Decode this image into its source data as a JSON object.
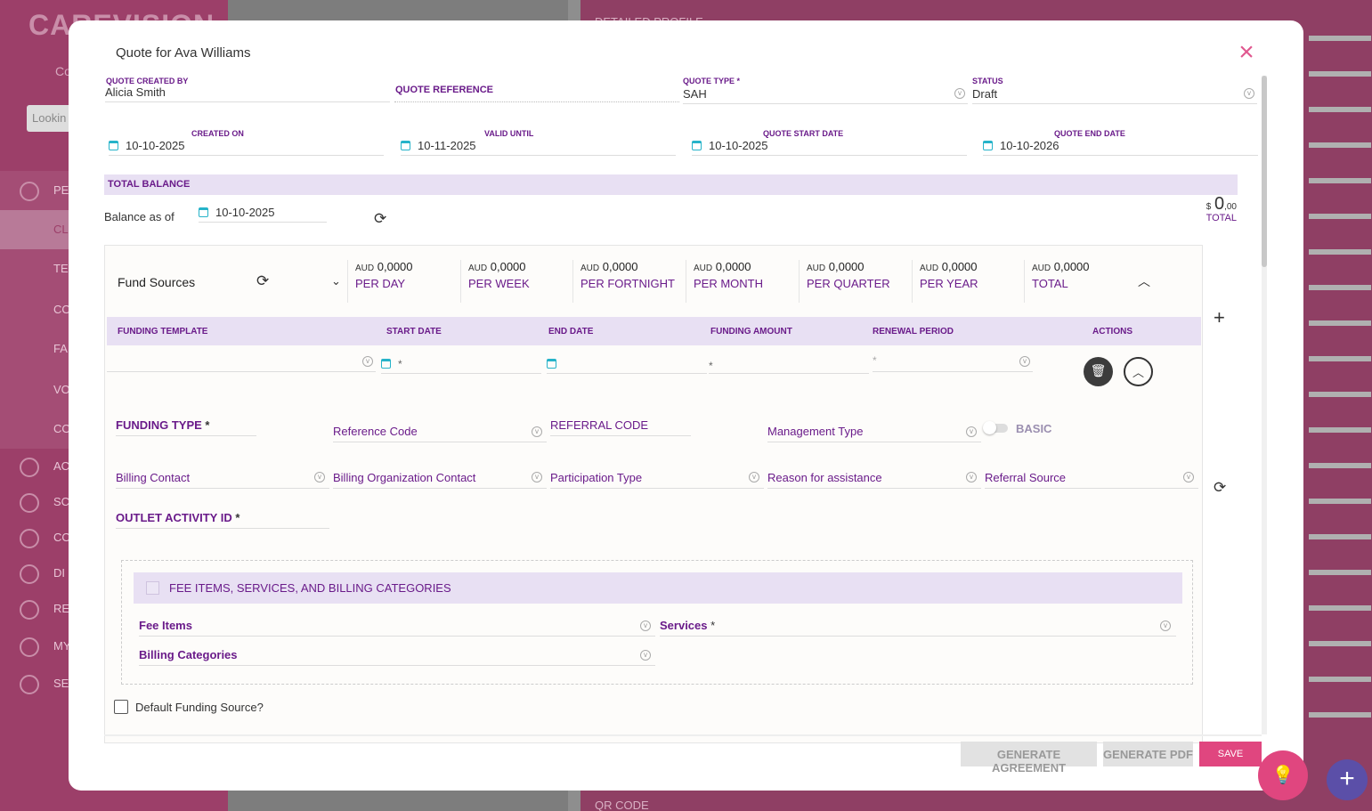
{
  "background": {
    "logo": "CAREVISION",
    "sub": "Co",
    "search_placeholder": "Lookin",
    "menu_items": [
      "PE",
      "CL",
      "TE",
      "CO",
      "FA",
      "VO",
      "CO",
      "AC",
      "SC",
      "CO",
      "DI",
      "RE",
      "MY",
      "SE"
    ],
    "right_top": "DETAILED PROFILE",
    "right_bottom": "QR CODE"
  },
  "modal": {
    "title": "Quote for Ava Williams",
    "close_icon": "close-icon"
  },
  "header_fields": {
    "created_by": {
      "label": "QUOTE CREATED BY",
      "value": "Alicia Smith"
    },
    "reference": {
      "label": "QUOTE REFERENCE",
      "value": ""
    },
    "quote_type": {
      "label": "QUOTE TYPE *",
      "value": "SAH"
    },
    "status": {
      "label": "STATUS",
      "value": "Draft"
    },
    "created_on": {
      "label": "CREATED ON",
      "value": "10-10-2025"
    },
    "valid_until": {
      "label": "VALID UNTIL",
      "value": "10-11-2025"
    },
    "start_date": {
      "label": "QUOTE START DATE",
      "value": "10-10-2025"
    },
    "end_date": {
      "label": "QUOTE END DATE",
      "value": "10-10-2026"
    }
  },
  "balance": {
    "band_label": "TOTAL BALANCE",
    "balance_as_of_label": "Balance as of",
    "balance_date": "10-10-2025",
    "total_currency": "$",
    "total_amount": "0",
    "total_decimals": ",00",
    "total_label": "TOTAL"
  },
  "fund_sources": {
    "label": "Fund Sources",
    "summaries": [
      {
        "currency": "AUD",
        "value": "0,0000",
        "period": "PER DAY"
      },
      {
        "currency": "AUD",
        "value": "0,0000",
        "period": "PER WEEK"
      },
      {
        "currency": "AUD",
        "value": "0,0000",
        "period": "PER FORTNIGHT"
      },
      {
        "currency": "AUD",
        "value": "0,0000",
        "period": "PER MONTH"
      },
      {
        "currency": "AUD",
        "value": "0,0000",
        "period": "PER QUARTER"
      },
      {
        "currency": "AUD",
        "value": "0,0000",
        "period": "PER YEAR"
      },
      {
        "currency": "AUD",
        "value": "0,0000",
        "period": "TOTAL"
      }
    ],
    "columns": [
      "FUNDING TEMPLATE",
      "START DATE",
      "END DATE",
      "FUNDING AMOUNT",
      "RENEWAL PERIOD",
      "ACTIONS"
    ],
    "required_marker": "*",
    "fields": {
      "funding_type": "FUNDING TYPE",
      "reference_code": "Reference Code",
      "referral_code": "REFERRAL CODE",
      "management_type": "Management Type",
      "basic_toggle": "BASIC",
      "billing_contact": "Billing Contact",
      "billing_org_contact": "Billing Organization Contact",
      "participation_type": "Participation Type",
      "reason_for_assistance": "Reason for assistance",
      "referral_source": "Referral Source",
      "outlet_activity_id": "OUTLET ACTIVITY ID"
    },
    "fee_section": {
      "title": "FEE ITEMS, SERVICES, AND BILLING CATEGORIES",
      "fee_items": "Fee Items",
      "services": "Services",
      "billing_categories": "Billing Categories"
    },
    "default_checkbox_label": "Default Funding Source?"
  },
  "footer": {
    "generate_agreement": "GENERATE AGREEMENT",
    "generate_pdf": "GENERATE PDF",
    "save": "SAVE"
  }
}
